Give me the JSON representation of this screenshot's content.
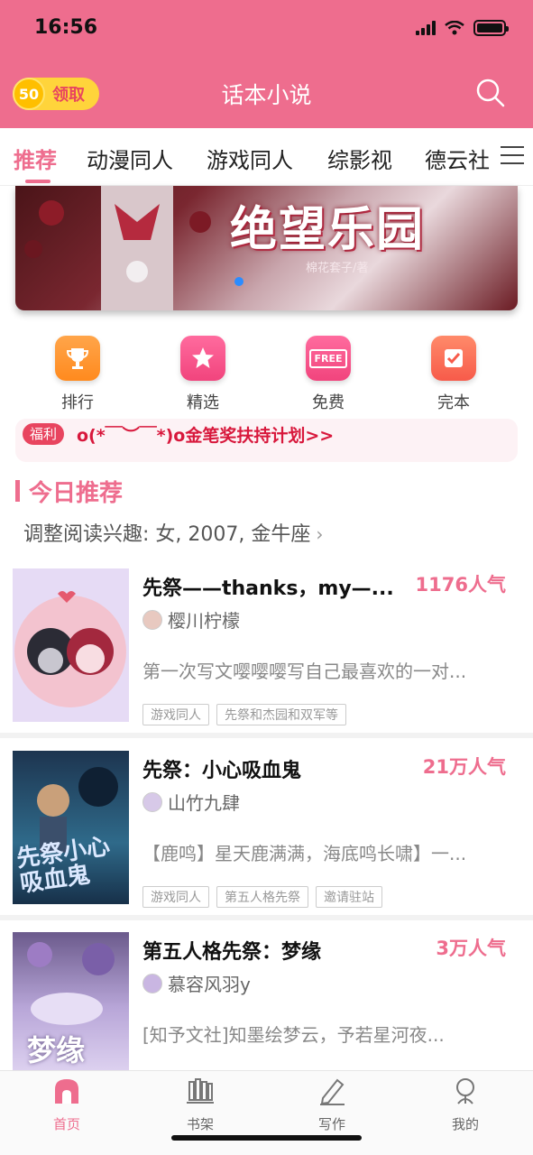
{
  "status_bar": {
    "time": "16:56"
  },
  "header": {
    "coin_count": "50",
    "coin_label": "领取",
    "title": "话本小说"
  },
  "tabs": [
    {
      "label": "推荐",
      "active": true
    },
    {
      "label": "动漫同人"
    },
    {
      "label": "游戏同人"
    },
    {
      "label": "综影视"
    },
    {
      "label": "德云社"
    }
  ],
  "banner": {
    "title": "绝望乐园",
    "author": "棉花套子/著"
  },
  "quick_links": [
    {
      "label": "排行",
      "icon": "trophy-icon"
    },
    {
      "label": "精选",
      "icon": "star-icon"
    },
    {
      "label": "免费",
      "icon": "free-icon",
      "badge": "FREE"
    },
    {
      "label": "完本",
      "icon": "checkmark-icon"
    }
  ],
  "notice": {
    "tag": "福利",
    "text": "o(*￣︶￣*)o金笔奖扶持计划>>"
  },
  "section": {
    "title": "今日推荐",
    "interest": "调整阅读兴趣: 女, 2007, 金牛座"
  },
  "books": [
    {
      "title": "先祭——thanks，my—...",
      "popularity": "1176人气",
      "author": "樱川柠檬",
      "desc": "第一次写文嘤嘤嘤写自己最喜欢的一对...",
      "tags": [
        "游戏同人",
        "先祭和杰园和双军等"
      ]
    },
    {
      "title": "先祭：小心吸血鬼",
      "popularity": "21万人气",
      "author": "山竹九肆",
      "desc": "【鹿鸣】星天鹿满满，海底鸣长啸】一...",
      "tags": [
        "游戏同人",
        "第五人格先祭",
        "邀请驻站"
      ],
      "cover_text": "先祭小心吸血鬼"
    },
    {
      "title": "第五人格先祭：梦缘",
      "popularity": "3万人气",
      "author": "慕容风羽y",
      "desc": "[知予文社]知墨绘梦云，予若星河夜...",
      "tags": [],
      "cover_text": "梦缘"
    }
  ],
  "bottom_nav": [
    {
      "label": "首页",
      "active": true
    },
    {
      "label": "书架"
    },
    {
      "label": "写作"
    },
    {
      "label": "我的"
    }
  ],
  "colors": {
    "brand": "#ee6d8e",
    "notice_red": "#d8183c",
    "coin": "#ffd43b"
  }
}
